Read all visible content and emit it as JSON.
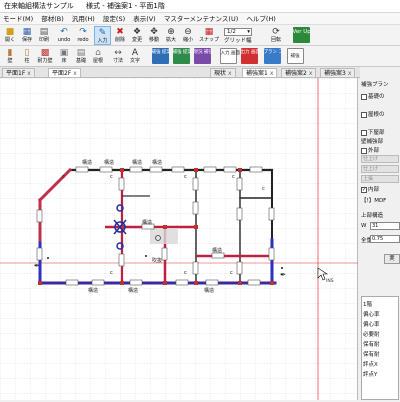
{
  "title_bar": {
    "app_name": "在来軸組構法サンプル",
    "window_title": "様式 - 補強案1 - 平面1階"
  },
  "menu": [
    "モード(M)",
    "部材(B)",
    "汎用(H)",
    "設定(S)",
    "表示(V)",
    "マスターメンテナンス(U)",
    "ヘルプ(H)"
  ],
  "toolbar1": {
    "buttons": [
      "開く",
      "保存",
      "印刷",
      "undo",
      "redo",
      "入力",
      "削除",
      "変更",
      "移動",
      "拡大",
      "縮小",
      "スナップ"
    ],
    "scale_value": "1/2",
    "grid_label": "グリッド幅",
    "rot_label": "回転",
    "verup_label": "Ver Up"
  },
  "toolbar2": {
    "buttons": [
      "壁",
      "柱",
      "耐力壁",
      "床",
      "基礎",
      "屋根",
      "寸法",
      "文字"
    ],
    "proposal_buttons": [
      "補強 提案",
      "補強 提案",
      "現況 補強"
    ],
    "input_screen_label": "入力 画面",
    "output_screen_label": "出力 画面",
    "plan_copy_label": "プラン コピー",
    "reinforce_label": "補強"
  },
  "tabs": [
    {
      "label": "平面1F",
      "x": "x"
    },
    {
      "label": "平面2F",
      "x": "x"
    },
    {
      "label": "現状",
      "x": "x"
    },
    {
      "label": "補強案1",
      "x": "x"
    },
    {
      "label": "補強案2",
      "x": "x"
    },
    {
      "label": "補強案3",
      "x": "x"
    }
  ],
  "canvas": {
    "room_labels": [
      "吹抜"
    ],
    "wall_labels": [
      "構造",
      "構造",
      "構造",
      "構造",
      "構造",
      "構造",
      "構造",
      "構造",
      "構造"
    ],
    "marker_labels": [
      "c",
      "c",
      "c",
      "c",
      "c",
      "c",
      "c",
      "c"
    ],
    "cursor_label": "INS"
  },
  "panel": {
    "header": "補強プラン",
    "checkboxes": [
      {
        "label": "基礎の",
        "checked": false
      },
      {
        "label": "屋根の",
        "checked": false
      },
      {
        "label": "下屋部",
        "checked": false
      }
    ],
    "wall_section": "壁補強部",
    "outer_label": "外部",
    "gray_values": [
      "仕上げ",
      "仕上げ",
      "上張"
    ],
    "inner_label": "内部",
    "mdf_label": "【!】MDF",
    "upper_structure_label": "上部構造",
    "wall_label": "W",
    "wall_value": "31",
    "full_weight_label": "全重",
    "full_weight_value": "0.75",
    "exec_button": "実",
    "evaluation_rows": [
      "1階",
      "偏心率",
      "偏心率",
      "必要耐",
      "保有耐",
      "保有耐",
      "評点X",
      "評点Y"
    ]
  }
}
